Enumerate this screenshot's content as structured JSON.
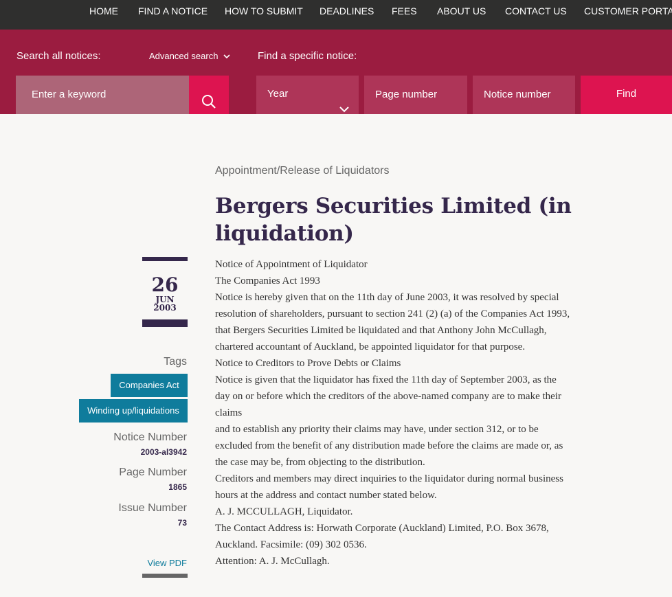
{
  "nav": {
    "home": "HOME",
    "find_notice": "FIND A NOTICE",
    "how_to_submit": "HOW TO SUBMIT",
    "deadlines": "DEADLINES",
    "fees": "FEES",
    "about_us": "ABOUT US",
    "contact_us": "CONTACT US",
    "customer_portal": "CUSTOMER PORTAL"
  },
  "search": {
    "all_label": "Search all notices:",
    "advanced": "Advanced search",
    "keyword_placeholder": "Enter a keyword",
    "specific_label": "Find a specific notice:",
    "year": "Year",
    "page_placeholder": "Page number",
    "notice_placeholder": "Notice number",
    "find": "Find"
  },
  "notice": {
    "category": "Appointment/Release of Liquidators",
    "title": "Bergers Securities Limited (in liquidation)",
    "date": {
      "day": "26",
      "month": "JUN",
      "year": "2003"
    },
    "tags_label": "Tags",
    "tags": [
      "Companies Act",
      "Winding up/liquidations"
    ],
    "notice_number_label": "Notice Number",
    "notice_number": "2003-al3942",
    "page_number_label": "Page Number",
    "page_number": "1865",
    "issue_number_label": "Issue Number",
    "issue_number": "73",
    "view_pdf": "View PDF",
    "body": [
      "Notice of Appointment of Liquidator",
      "The Companies Act 1993",
      "Notice is hereby given that on the 11th day of June 2003, it was resolved by special resolution of shareholders, pursuant to section 241 (2) (a) of the Companies Act 1993, that Bergers Securities Limited be liquidated and that Anthony John McCullagh, chartered accountant of Auckland, be appointed liquidator for that purpose.",
      "Notice to Creditors to Prove Debts or Claims",
      "Notice is given that the liquidator has fixed the 11th day of September 2003, as the day on or before which the creditors of the above-named company are to make their claims",
      "and to establish any priority their claims may have, under section 312, or to be excluded from the benefit of any distribution made before the claims are made or, as the case may be, from objecting to the distribution.",
      "Creditors and members may direct inquiries to the liquidator during normal business hours at the address and contact number stated below.",
      "A. J. MCCULLAGH, Liquidator.",
      "The Contact Address is: Horwath Corporate (Auckland) Limited, P.O. Box 3678, Auckland. Facsimile: (09) 302 0536.",
      "Attention: A. J. McCullagh."
    ]
  }
}
